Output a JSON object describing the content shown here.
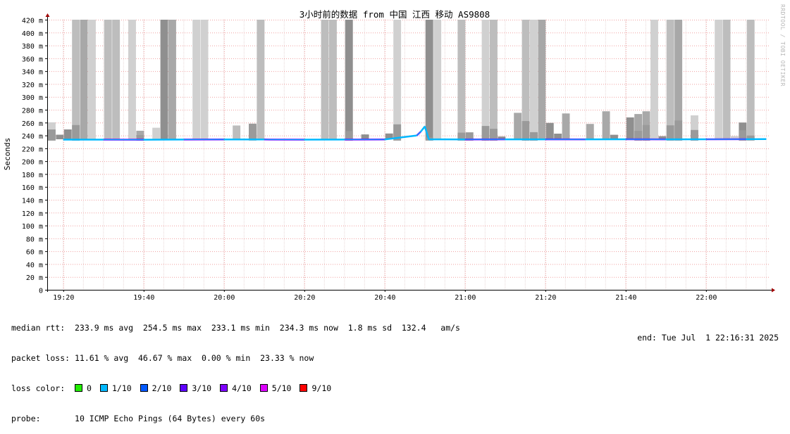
{
  "chart_data": {
    "type": "line",
    "title": "3小时前的数据 from 中国 江西 移动 AS9808",
    "ylabel": "Seconds",
    "xlabel": "",
    "ylim": [
      0,
      420
    ],
    "y_unit": "ms",
    "y_ticks": [
      "0",
      "20 m",
      "40 m",
      "60 m",
      "80 m",
      "100 m",
      "120 m",
      "140 m",
      "160 m",
      "180 m",
      "200 m",
      "220 m",
      "240 m",
      "260 m",
      "280 m",
      "300 m",
      "320 m",
      "340 m",
      "360 m",
      "380 m",
      "400 m",
      "420 m"
    ],
    "x_ticks": [
      "19:20",
      "19:40",
      "20:00",
      "20:20",
      "20:40",
      "21:00",
      "21:20",
      "21:40",
      "22:00"
    ],
    "x_range": [
      "19:16",
      "22:16"
    ],
    "grid": true,
    "series": [
      {
        "name": "median rtt",
        "x": [
          "19:20",
          "19:30",
          "19:40",
          "19:50",
          "20:00",
          "20:10",
          "20:20",
          "20:30",
          "20:40",
          "20:48",
          "20:49",
          "20:50",
          "20:51",
          "21:00",
          "21:10",
          "21:20",
          "21:30",
          "21:40",
          "21:50",
          "22:00",
          "22:10",
          "22:15"
        ],
        "values": [
          233.5,
          233.5,
          233.4,
          233.6,
          233.8,
          233.7,
          233.5,
          233.6,
          233.8,
          240,
          246,
          254,
          234,
          233.8,
          233.9,
          234,
          234,
          234.1,
          233.9,
          234.1,
          234.2,
          234.3
        ]
      }
    ],
    "loss_colors": [
      "#22ee00",
      "#00b8ff",
      "#0059ff",
      "#5e00ff",
      "#7e00ff",
      "#dd00ff",
      "#ff0000"
    ]
  },
  "stats": {
    "rtt_line": "median rtt:  233.9 ms avg  254.5 ms max  233.1 ms min  234.3 ms now  1.8 ms sd  132.4   am/s",
    "loss_line": "packet loss: 11.61 % avg  46.67 % max  0.00 % min  23.33 % now",
    "loss_color_label": "loss color:",
    "loss_levels": [
      {
        "label": "0",
        "color": "#22ee00"
      },
      {
        "label": "1/10",
        "color": "#00b8ff"
      },
      {
        "label": "2/10",
        "color": "#0059ff"
      },
      {
        "label": "3/10",
        "color": "#5e00ff"
      },
      {
        "label": "4/10",
        "color": "#7e00ff"
      },
      {
        "label": "5/10",
        "color": "#dd00ff"
      },
      {
        "label": "9/10",
        "color": "#ff0000"
      }
    ],
    "probe_label": "probe:",
    "probe_value": "10 ICMP Echo Pings (64 Bytes) every 60s",
    "end_text": "end: Tue Jul  1 22:16:31 2025"
  },
  "watermark": "RRDTOOL / TOBI OETIKER"
}
